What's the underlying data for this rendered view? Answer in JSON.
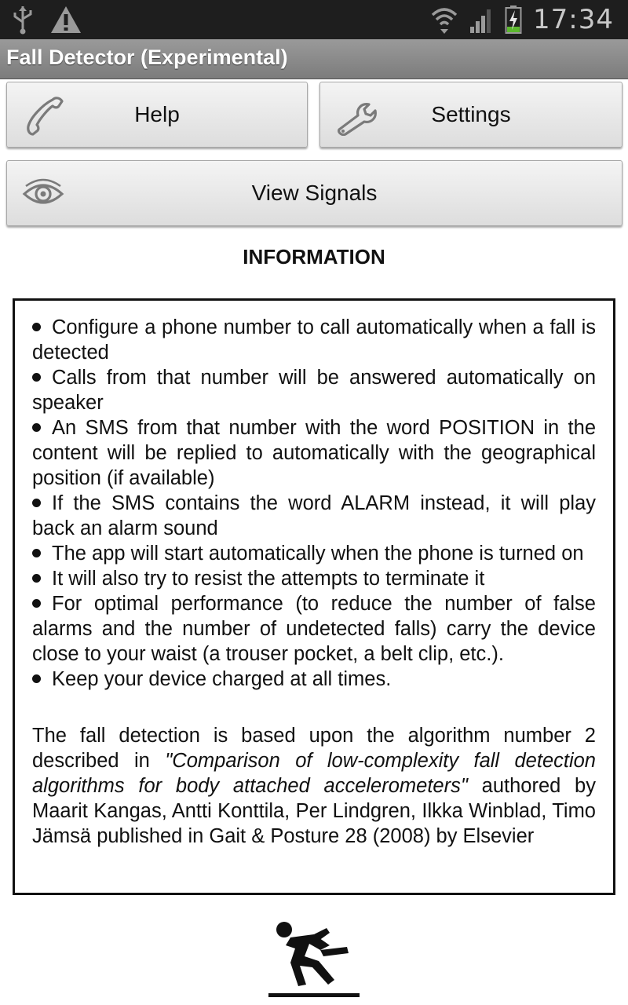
{
  "status_bar": {
    "time": "17:34",
    "icons": [
      "usb-icon",
      "warning-icon",
      "wifi-icon",
      "signal-icon",
      "battery-charging-icon"
    ]
  },
  "app": {
    "title": "Fall Detector (Experimental)"
  },
  "buttons": {
    "help_label": "Help",
    "help_icon": "phone-icon",
    "settings_label": "Settings",
    "settings_icon": "wrench-icon",
    "view_signals_label": "View Signals",
    "view_signals_icon": "eye-icon"
  },
  "info": {
    "heading": "INFORMATION",
    "items": [
      "Configure a phone number to call automatically when a fall is detected",
      "Calls from that number will be answered automatically on speaker",
      "An SMS from that number with the word POSITION in the content will be replied to automatically with the geographical position (if available)",
      "If the SMS contains the word ALARM instead, it will play back an alarm sound",
      "The app will start automatically when the phone is turned on",
      "It will also try to resist the attempts to terminate it",
      "For optimal performance (to reduce the number of false alarms and the number of undetected falls) carry the device close to your waist (a trouser pocket, a belt clip, etc.).",
      "Keep your device charged at all times."
    ],
    "credit_prefix": "The fall detection is based upon the algorithm number 2 described in ",
    "credit_title": "\"Comparison of low-complexity fall detection algorithms for body attached accelerometers\"",
    "credit_suffix": " authored by Maarit Kangas, Antti Konttila, Per Lindgren, Ilkka Winblad, Timo Jämsä published in Gait & Posture 28 (2008) by Elsevier"
  },
  "footer_icon": "falling-person-icon"
}
